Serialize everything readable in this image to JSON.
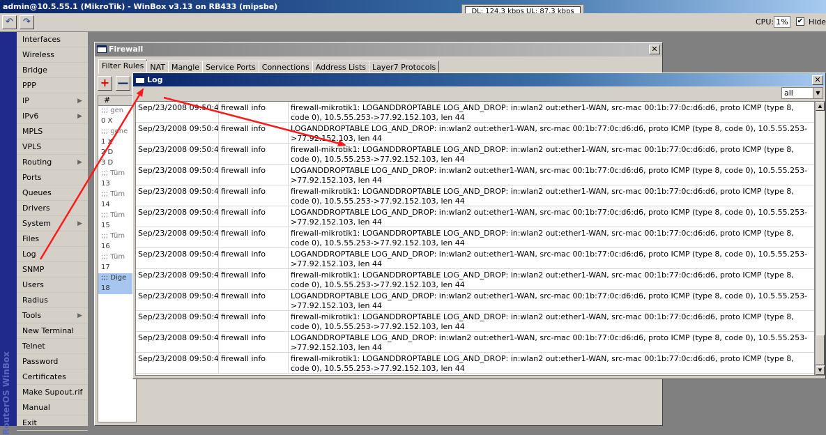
{
  "window": {
    "title": "admin@10.5.55.1 (MikroTik) - WinBox v3.13 on RB433 (mipsbe)"
  },
  "speed": {
    "text": "DL: 124,3 kbps  UL: 87,3 kbps"
  },
  "toolbar": {
    "undo_icon": "undo-icon",
    "redo_icon": "redo-icon",
    "cpu_label": "CPU:",
    "cpu_value": "1%",
    "hide_label": "Hide",
    "hide_checked": true
  },
  "brand": "RouterOS WinBox",
  "menu": [
    {
      "label": "Interfaces",
      "arrow": false
    },
    {
      "label": "Wireless",
      "arrow": false
    },
    {
      "label": "Bridge",
      "arrow": false
    },
    {
      "label": "PPP",
      "arrow": false
    },
    {
      "label": "IP",
      "arrow": true
    },
    {
      "label": "IPv6",
      "arrow": true
    },
    {
      "label": "MPLS",
      "arrow": false
    },
    {
      "label": "VPLS",
      "arrow": false
    },
    {
      "label": "Routing",
      "arrow": true
    },
    {
      "label": "Ports",
      "arrow": false
    },
    {
      "label": "Queues",
      "arrow": false
    },
    {
      "label": "Drivers",
      "arrow": false
    },
    {
      "label": "System",
      "arrow": true
    },
    {
      "label": "Files",
      "arrow": false
    },
    {
      "label": "Log",
      "arrow": false
    },
    {
      "label": "SNMP",
      "arrow": false
    },
    {
      "label": "Users",
      "arrow": false
    },
    {
      "label": "Radius",
      "arrow": false
    },
    {
      "label": "Tools",
      "arrow": true
    },
    {
      "label": "New Terminal",
      "arrow": false
    },
    {
      "label": "Telnet",
      "arrow": false
    },
    {
      "label": "Password",
      "arrow": false
    },
    {
      "label": "Certificates",
      "arrow": false
    },
    {
      "label": "Make Supout.rif",
      "arrow": false
    },
    {
      "label": "Manual",
      "arrow": false
    },
    {
      "label": "Exit",
      "arrow": false
    }
  ],
  "firewall": {
    "title": "Firewall",
    "tabs": [
      "Filter Rules",
      "NAT",
      "Mangle",
      "Service Ports",
      "Connections",
      "Address Lists",
      "Layer7 Protocols"
    ],
    "add_label": "+",
    "remove_label": "—",
    "col_header": "#",
    "rows": [
      {
        "text": ";;; gen",
        "kind": "c"
      },
      {
        "text": "0 X",
        "kind": "n"
      },
      {
        "text": ";;; gene",
        "kind": "c"
      },
      {
        "text": "1 X",
        "kind": "n"
      },
      {
        "text": "2 D",
        "kind": "n"
      },
      {
        "text": "3 D",
        "kind": "n"
      },
      {
        "text": ";;; Tüm",
        "kind": "c"
      },
      {
        "text": "13",
        "kind": "n"
      },
      {
        "text": ";;; Tüm",
        "kind": "c"
      },
      {
        "text": "14",
        "kind": "n"
      },
      {
        "text": ";;; Tüm",
        "kind": "c"
      },
      {
        "text": "15",
        "kind": "n"
      },
      {
        "text": ";;; Tüm",
        "kind": "c"
      },
      {
        "text": "16",
        "kind": "n"
      },
      {
        "text": ";;; Tüm",
        "kind": "c"
      },
      {
        "text": "17",
        "kind": "n"
      },
      {
        "text": ";;; Dige",
        "kind": "sel"
      },
      {
        "text": "18",
        "kind": "sel"
      }
    ]
  },
  "log": {
    "title": "Log",
    "filter_value": "all",
    "entries": [
      {
        "time": "Sep/23/2008 09:50:48",
        "topics": "firewall info",
        "message": "firewall-mikrotik1: LOGANDDROPTABLE LOG_AND_DROP: in:wlan2 out:ether1-WAN, src-mac 00:1b:77:0c:d6:d6, proto ICMP (type 8, code 0), 10.5.55.253->77.92.152.103, len 44"
      },
      {
        "time": "Sep/23/2008 09:50:48",
        "topics": "firewall info",
        "message": "LOGANDDROPTABLE LOG_AND_DROP: in:wlan2 out:ether1-WAN, src-mac 00:1b:77:0c:d6:d6, proto ICMP (type 8, code 0), 10.5.55.253->77.92.152.103, len 44"
      },
      {
        "time": "Sep/23/2008 09:50:48",
        "topics": "firewall info",
        "message": "firewall-mikrotik1: LOGANDDROPTABLE LOG_AND_DROP: in:wlan2 out:ether1-WAN, src-mac 00:1b:77:0c:d6:d6, proto ICMP (type 8, code 0), 10.5.55.253->77.92.152.103, len 44"
      },
      {
        "time": "Sep/23/2008 09:50:48",
        "topics": "firewall info",
        "message": "LOGANDDROPTABLE LOG_AND_DROP: in:wlan2 out:ether1-WAN, src-mac 00:1b:77:0c:d6:d6, proto ICMP (type 8, code 0), 10.5.55.253->77.92.152.103, len 44"
      },
      {
        "time": "Sep/23/2008 09:50:48",
        "topics": "firewall info",
        "message": "firewall-mikrotik1: LOGANDDROPTABLE LOG_AND_DROP: in:wlan2 out:ether1-WAN, src-mac 00:1b:77:0c:d6:d6, proto ICMP (type 8, code 0), 10.5.55.253->77.92.152.103, len 44"
      },
      {
        "time": "Sep/23/2008 09:50:48",
        "topics": "firewall info",
        "message": "LOGANDDROPTABLE LOG_AND_DROP: in:wlan2 out:ether1-WAN, src-mac 00:1b:77:0c:d6:d6, proto ICMP (type 8, code 0), 10.5.55.253->77.92.152.103, len 44"
      },
      {
        "time": "Sep/23/2008 09:50:48",
        "topics": "firewall info",
        "message": "firewall-mikrotik1: LOGANDDROPTABLE LOG_AND_DROP: in:wlan2 out:ether1-WAN, src-mac 00:1b:77:0c:d6:d6, proto ICMP (type 8, code 0), 10.5.55.253->77.92.152.103, len 44"
      },
      {
        "time": "Sep/23/2008 09:50:48",
        "topics": "firewall info",
        "message": "LOGANDDROPTABLE LOG_AND_DROP: in:wlan2 out:ether1-WAN, src-mac 00:1b:77:0c:d6:d6, proto ICMP (type 8, code 0), 10.5.55.253->77.92.152.103, len 44"
      },
      {
        "time": "Sep/23/2008 09:50:48",
        "topics": "firewall info",
        "message": "firewall-mikrotik1: LOGANDDROPTABLE LOG_AND_DROP: in:wlan2 out:ether1-WAN, src-mac 00:1b:77:0c:d6:d6, proto ICMP (type 8, code 0), 10.5.55.253->77.92.152.103, len 44"
      },
      {
        "time": "Sep/23/2008 09:50:48",
        "topics": "firewall info",
        "message": "LOGANDDROPTABLE LOG_AND_DROP: in:wlan2 out:ether1-WAN, src-mac 00:1b:77:0c:d6:d6, proto ICMP (type 8, code 0), 10.5.55.253->77.92.152.103, len 44"
      },
      {
        "time": "Sep/23/2008 09:50:48",
        "topics": "firewall info",
        "message": "firewall-mikrotik1: LOGANDDROPTABLE LOG_AND_DROP: in:wlan2 out:ether1-WAN, src-mac 00:1b:77:0c:d6:d6, proto ICMP (type 8, code 0), 10.5.55.253->77.92.152.103, len 44"
      },
      {
        "time": "Sep/23/2008 09:50:48",
        "topics": "firewall info",
        "message": "LOGANDDROPTABLE LOG_AND_DROP: in:wlan2 out:ether1-WAN, src-mac 00:1b:77:0c:d6:d6, proto ICMP (type 8, code 0), 10.5.55.253->77.92.152.103, len 44"
      },
      {
        "time": "Sep/23/2008 09:50:48",
        "topics": "firewall info",
        "message": "firewall-mikrotik1: LOGANDDROPTABLE LOG_AND_DROP: in:wlan2 out:ether1-WAN, src-mac 00:1b:77:0c:d6:d6, proto ICMP (type 8, code 0), 10.5.55.253->77.92.152.103, len 44"
      }
    ]
  },
  "colors": {
    "arrow": "#ff1a1a",
    "title_active": "#0a246a",
    "menu_strip": "#202a8c"
  }
}
